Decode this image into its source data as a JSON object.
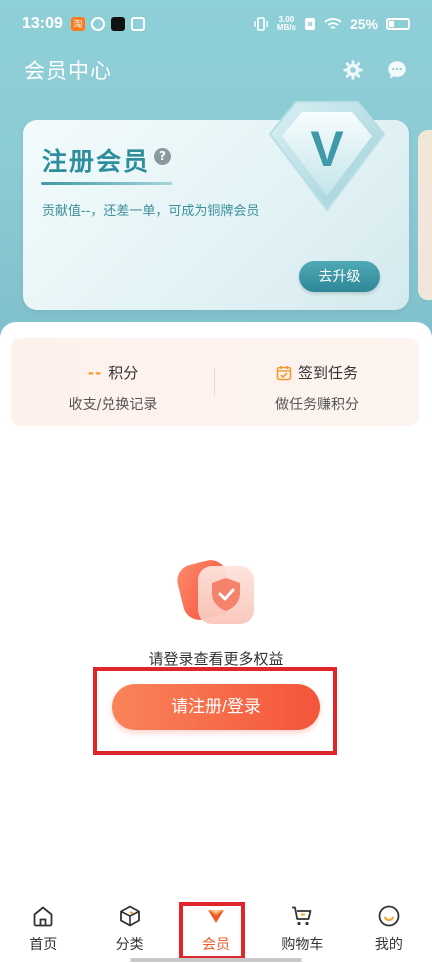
{
  "status_bar": {
    "time": "13:09",
    "net_speed_value": "3.00",
    "net_speed_unit": "MB/s",
    "battery": "25%"
  },
  "header": {
    "title": "会员中心"
  },
  "member_card": {
    "title": "注册会员",
    "help": "?",
    "description": "贡献值--，还差一单，可成为铜牌会员",
    "badge_letter": "V",
    "upgrade_label": "去升级"
  },
  "points": {
    "score_value": "--",
    "score_label": "积分",
    "score_sub": "收支/兑换记录",
    "checkin_label": "签到任务",
    "checkin_sub": "做任务赚积分"
  },
  "empty_state": {
    "hint": "请登录查看更多权益",
    "login_label": "请注册/登录"
  },
  "nav": {
    "items": [
      {
        "label": "首页",
        "icon": "home-icon"
      },
      {
        "label": "分类",
        "icon": "category-icon"
      },
      {
        "label": "会员",
        "icon": "member-icon"
      },
      {
        "label": "购物车",
        "icon": "cart-icon"
      },
      {
        "label": "我的",
        "icon": "profile-icon"
      }
    ]
  },
  "colors": {
    "hero": "#8fcfd7",
    "brand_teal": "#2f8e9c",
    "accent_orange": "#f4553a",
    "highlight_red": "#e0252b"
  }
}
